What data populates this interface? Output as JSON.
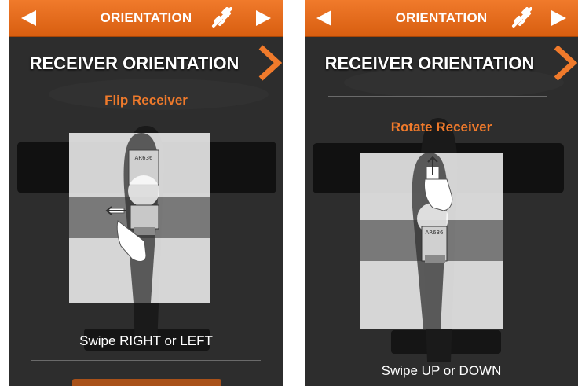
{
  "screens": [
    {
      "header": {
        "title": "ORIENTATION",
        "back_icon": "left-triangle-icon",
        "next_icon": "right-triangle-icon",
        "link_icon": "broken-link-icon"
      },
      "heading": "RECEIVER ORIENTATION",
      "subtitle": "Flip Receiver",
      "instruction": "Swipe RIGHT or LEFT",
      "receiver_label": "AR636"
    },
    {
      "header": {
        "title": "ORIENTATION",
        "back_icon": "left-triangle-icon",
        "next_icon": "right-triangle-icon",
        "link_icon": "broken-link-icon"
      },
      "heading": "RECEIVER ORIENTATION",
      "subtitle": "Rotate Receiver",
      "instruction": "Swipe UP or DOWN",
      "receiver_label": "AR636"
    }
  ],
  "colors": {
    "accent": "#f07a2b",
    "background": "#2b2b2b",
    "text": "#ffffff"
  }
}
